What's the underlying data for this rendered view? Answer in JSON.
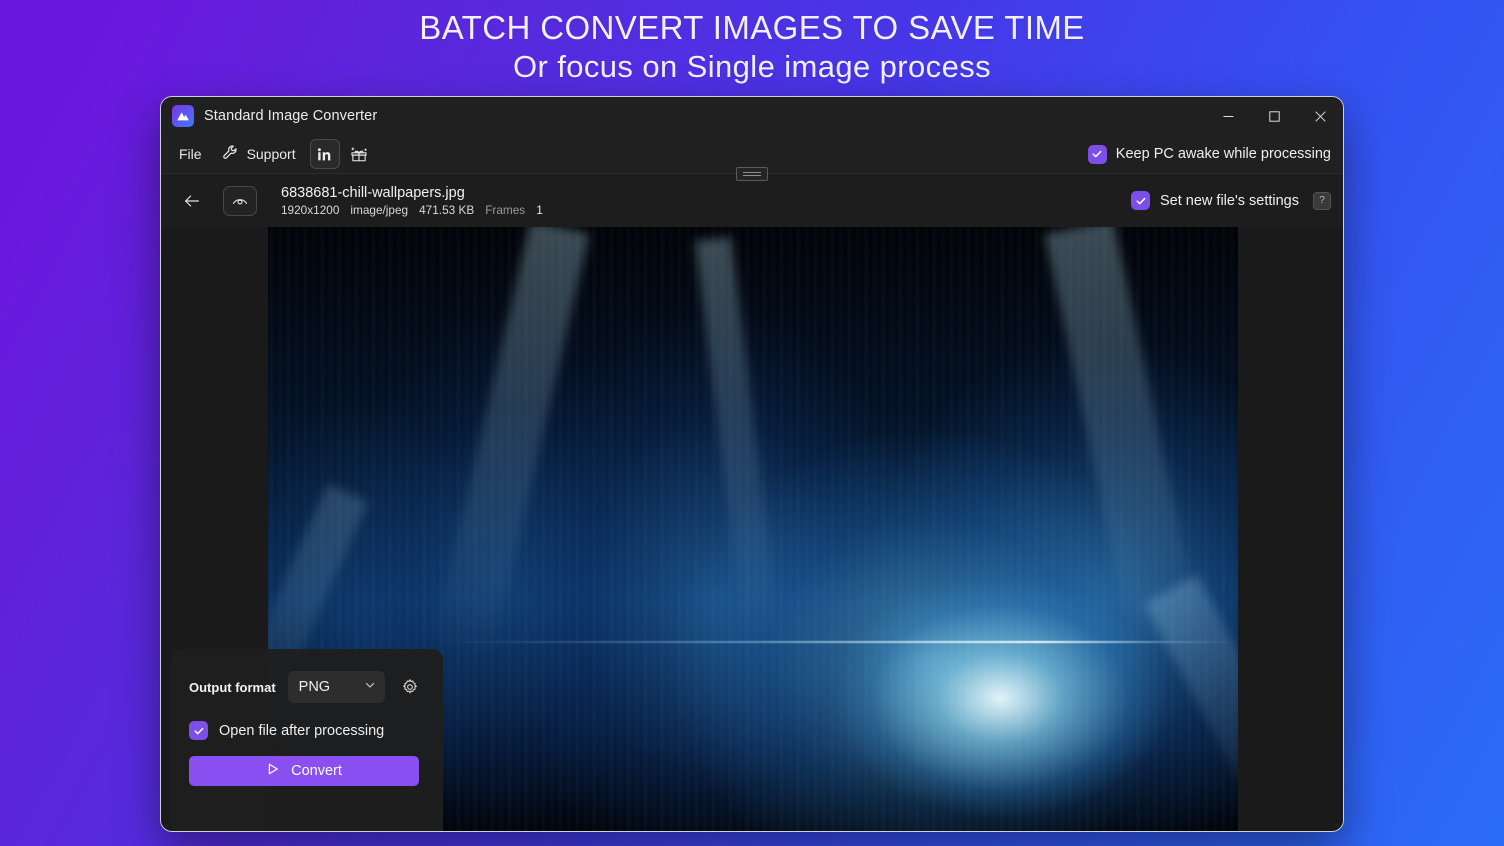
{
  "promo": {
    "line1": "BATCH CONVERT IMAGES TO SAVE TIME",
    "line2": "Or focus on Single image process"
  },
  "window": {
    "title": "Standard Image Converter",
    "app_icon": "mountain-logo-icon",
    "controls": {
      "minimize": "minimize-icon",
      "maximize": "maximize-icon",
      "close": "close-icon"
    }
  },
  "menubar": {
    "file_label": "File",
    "support_label": "Support",
    "support_icon": "wrench-icon",
    "linkedin_icon": "linkedin-icon",
    "whats_new_icon": "gift-sparkle-icon",
    "drag_handle": "window-drag-handle",
    "keep_awake": {
      "label": "Keep PC awake while processing",
      "checked": true
    }
  },
  "filebar": {
    "back_icon": "arrow-left-icon",
    "preview_icon": "eye-icon",
    "filename": "6838681-chill-wallpapers.jpg",
    "dimensions": "1920x1200",
    "mimetype": "image/jpeg",
    "filesize": "471.53 KB",
    "frames_label": "Frames",
    "frames_value": "1",
    "new_file_settings": {
      "label": "Set new file's settings",
      "checked": true,
      "help_badge": "?"
    }
  },
  "settings_card": {
    "output_format_label": "Output format",
    "output_format_value": "PNG",
    "output_format_options": [
      "PNG"
    ],
    "dropdown_icon": "chevron-down-icon",
    "advanced_icon": "gear-icon",
    "open_file": {
      "label": "Open file after processing",
      "checked": true
    },
    "convert_label": "Convert",
    "convert_icon": "play-triangle-icon"
  },
  "preview": {
    "alt": "aurora-wallpaper-preview"
  },
  "colors": {
    "accent_purple": "#8A4FF0",
    "checkbox_purple": "#7C4FE8",
    "window_bg": "#1b1b1b",
    "titlebar_bg": "#202020",
    "bg_gradient_start": "#6A17DD",
    "bg_gradient_end": "#2B6CF6"
  }
}
